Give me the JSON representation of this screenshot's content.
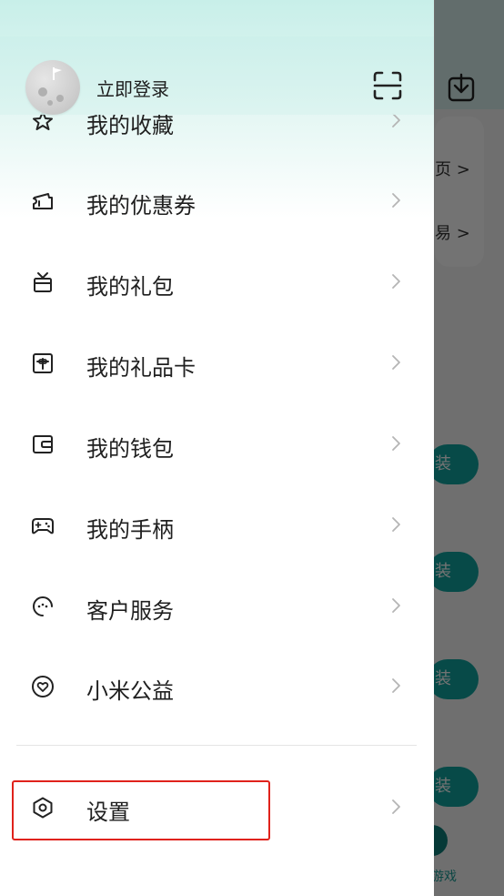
{
  "drawer": {
    "login_label": "立即登录",
    "menu": [
      {
        "id": "favorites",
        "label": "我的收藏",
        "icon": "star-icon"
      },
      {
        "id": "coupons",
        "label": "我的优惠券",
        "icon": "coupon-icon"
      },
      {
        "id": "gifts",
        "label": "我的礼包",
        "icon": "gift-icon"
      },
      {
        "id": "giftcard",
        "label": "我的礼品卡",
        "icon": "gift-card-icon"
      },
      {
        "id": "wallet",
        "label": "我的钱包",
        "icon": "wallet-icon"
      },
      {
        "id": "gamepad",
        "label": "我的手柄",
        "icon": "gamepad-icon"
      },
      {
        "id": "service",
        "label": "客户服务",
        "icon": "customer-service-icon"
      },
      {
        "id": "charity",
        "label": "小米公益",
        "icon": "heart-icon"
      }
    ],
    "settings_label": "设置"
  },
  "background": {
    "card_texts": [
      "页 >",
      "易 >"
    ],
    "pill_labels": [
      "装",
      "装",
      "装",
      "装"
    ],
    "bottom_label": "游戏"
  },
  "colors": {
    "accent": "#11a5a0",
    "highlight": "#e0221b",
    "header_gradient_top": "#c8efe9"
  }
}
